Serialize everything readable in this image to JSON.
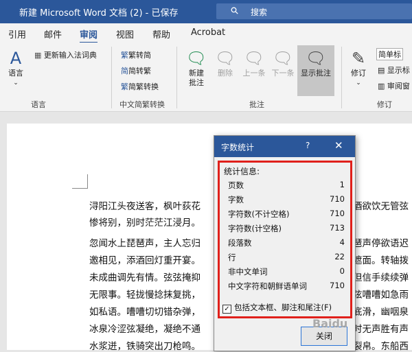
{
  "window": {
    "title": "新建 Microsoft Word 文档 (2) - 已保存",
    "search_label": "搜索"
  },
  "tabs": [
    "引用",
    "邮件",
    "审阅",
    "视图",
    "帮助",
    "Acrobat"
  ],
  "ribbon": {
    "language": {
      "lang_btn": "语言",
      "update_ime": "更新输入法词典",
      "group": "语言"
    },
    "convert": {
      "to_simplified": "繁转简",
      "to_traditional": "简转繁",
      "convert": "简繁转换",
      "group": "中文简繁转换"
    },
    "comments": {
      "new_comment": [
        "新建",
        "批注"
      ],
      "delete": "删除",
      "previous": "上一条",
      "next": "下一条",
      "show": "显示批注",
      "group": "批注"
    },
    "tracking": {
      "track": "修订",
      "simple_markup": "简单标",
      "show_markup": "显示标",
      "review_pane": "审阅窗",
      "group": "修订"
    }
  },
  "document": {
    "lines": [
      "浔阳江头夜送客，枫叶荻花",
      "惨将别，别时茫茫江浸月。",
      "忽闻水上琵琶声，主人忘归",
      "邀相见，添酒回灯重开宴。",
      "未成曲调先有情。弦弦掩抑",
      "无限事。轻拢慢捻抹复挑，",
      "如私语。嘈嘈切切错杂弹，",
      "冰泉冷涩弦凝绝，凝绝不通",
      "水浆迸，铁骑突出刀枪鸣。"
    ],
    "right_fragments": [
      "酒欲饮无管弦",
      "琶声停欲语迟",
      "遮面。转轴拨",
      "但信手续续弹",
      "弦嘈嘈如急雨",
      "底滑，幽咽泉",
      "时无声胜有声",
      "裂帛。东船西"
    ]
  },
  "dialog": {
    "title": "字数统计",
    "help": "?",
    "close_x": "✕",
    "stats_header": "统计信息:",
    "stats": [
      {
        "label": "页数",
        "value": "1"
      },
      {
        "label": "字数",
        "value": "710"
      },
      {
        "label": "字符数(不计空格)",
        "value": "710"
      },
      {
        "label": "字符数(计空格)",
        "value": "713"
      },
      {
        "label": "段落数",
        "value": "4"
      },
      {
        "label": "行",
        "value": "22"
      },
      {
        "label": "非中文单词",
        "value": "0"
      },
      {
        "label": "中文字符和朝鲜语单词",
        "value": "710"
      }
    ],
    "include_textboxes": "包括文本框、脚注和尾注(F)",
    "close_button": "关闭"
  },
  "watermark": "Baidu"
}
